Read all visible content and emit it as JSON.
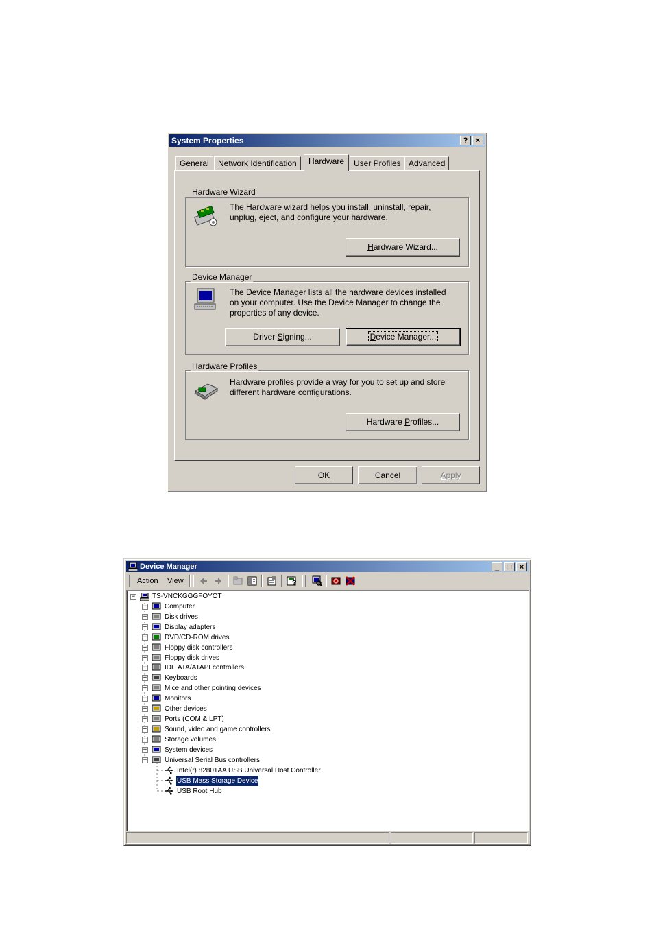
{
  "system_properties": {
    "title": "System Properties",
    "title_buttons": [
      "?",
      "×"
    ],
    "tabs": [
      "General",
      "Network Identification",
      "Hardware",
      "User Profiles",
      "Advanced"
    ],
    "active_tab": "Hardware",
    "hardware_wizard": {
      "group_label": "Hardware Wizard",
      "description_line1": "The Hardware wizard helps you install, uninstall, repair,",
      "description_line2": "unplug, eject, and configure your hardware.",
      "button_pre": "",
      "button_key": "H",
      "button_post": "ardware Wizard..."
    },
    "device_manager": {
      "group_label": "Device Manager",
      "description_line1": "The Device Manager lists all the hardware devices installed",
      "description_line2": "on your computer. Use the Device Manager to change the",
      "description_line3": "properties of any device.",
      "driver_signing_pre": "Driver ",
      "driver_signing_key": "S",
      "driver_signing_post": "igning...",
      "device_manager_pre": "",
      "device_manager_key": "D",
      "device_manager_post": "evice Manager..."
    },
    "hardware_profiles": {
      "group_label": "Hardware Profiles",
      "description_line1": "Hardware profiles provide a way for you to set up and store",
      "description_line2": "different hardware configurations.",
      "button_pre": "Hardware ",
      "button_key": "P",
      "button_post": "rofiles..."
    },
    "ok_label": "OK",
    "cancel_label": "Cancel",
    "apply_pre": "",
    "apply_key": "A",
    "apply_post": "pply"
  },
  "device_manager_window": {
    "title": "Device Manager",
    "title_buttons": [
      "_",
      "□",
      "×"
    ],
    "menu": {
      "action_key": "A",
      "action_rest": "ction",
      "view_key": "V",
      "view_rest": "iew"
    },
    "toolbar_icons": [
      "back-arrow-icon",
      "forward-arrow-icon",
      "up-folder-icon",
      "show-hide-tree-icon",
      "properties-icon",
      "help-icon",
      "scan-hardware-icon",
      "disable-device-icon",
      "uninstall-device-icon"
    ],
    "root": "TS-VNCKGGGFOYOT",
    "categories": [
      "Computer",
      "Disk drives",
      "Display adapters",
      "DVD/CD-ROM drives",
      "Floppy disk controllers",
      "Floppy disk drives",
      "IDE ATA/ATAPI controllers",
      "Keyboards",
      "Mice and other pointing devices",
      "Monitors",
      "Other devices",
      "Ports (COM & LPT)",
      "Sound, video and game controllers",
      "Storage volumes",
      "System devices",
      "Universal Serial Bus controllers"
    ],
    "usb_children": [
      "Intel(r) 82801AA USB Universal Host Controller",
      "USB Mass Storage Device",
      "USB Root Hub"
    ],
    "selected_item": "USB Mass Storage Device"
  }
}
